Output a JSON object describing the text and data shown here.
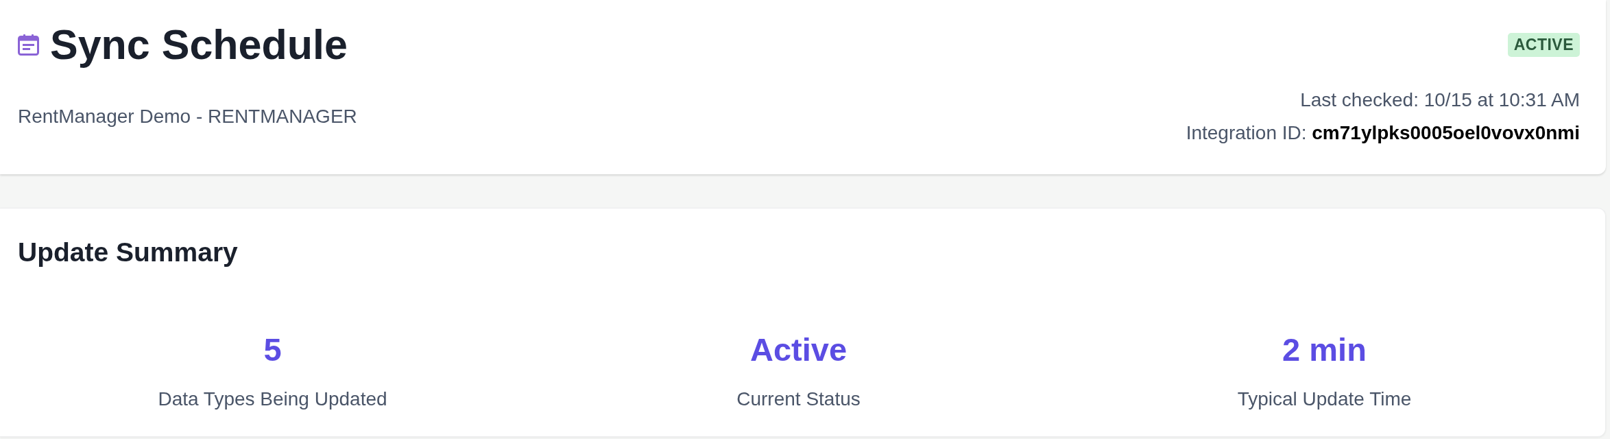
{
  "header": {
    "title": "Sync Schedule",
    "status_badge": "ACTIVE",
    "subtitle": "RentManager Demo - RENTMANAGER",
    "last_checked": "Last checked: 10/15 at 10:31 AM",
    "integration_id": "Integration ID: **cm71ylpks0005oel0vovx0nmi**"
  },
  "summary": {
    "title": "Update Summary",
    "stats": [
      {
        "value": "5",
        "label": "Data Types Being Updated"
      },
      {
        "value": "Active",
        "label": "Current Status"
      },
      {
        "value": "2 min",
        "label": "Typical Update Time"
      }
    ]
  }
}
